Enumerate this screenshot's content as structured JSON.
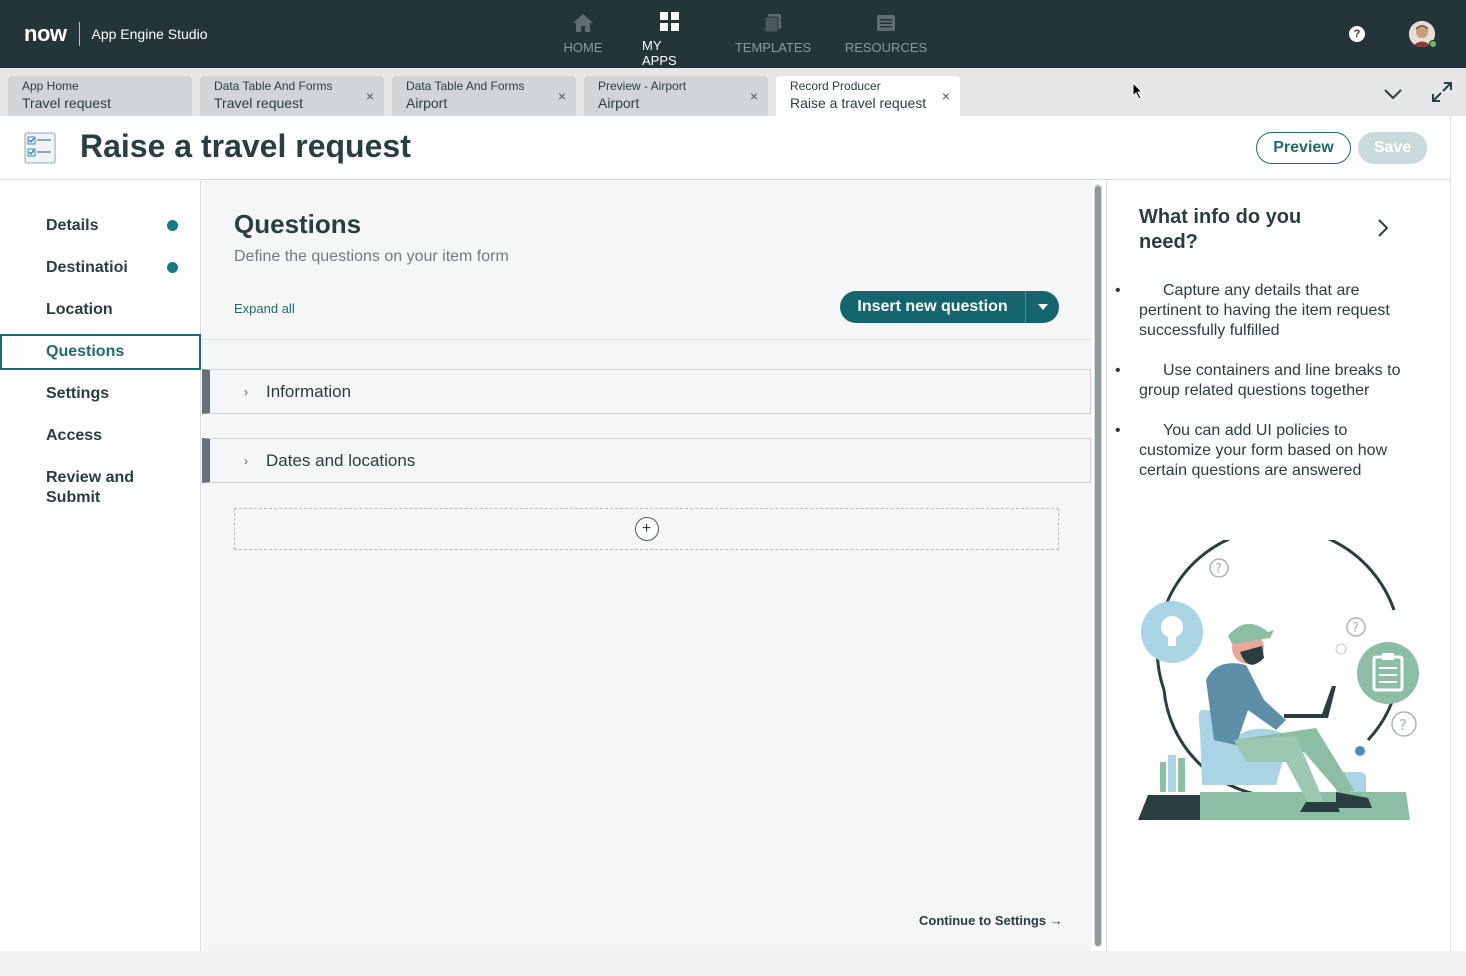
{
  "app": {
    "logo_text": "now",
    "name": "App Engine Studio",
    "help_symbol": "?"
  },
  "topnav": [
    {
      "label": "HOME",
      "icon": "home-icon",
      "active": false
    },
    {
      "label": "MY APPS",
      "icon": "grid-icon",
      "active": true
    },
    {
      "label": "TEMPLATES",
      "icon": "templates-icon",
      "active": false
    },
    {
      "label": "RESOURCES",
      "icon": "resources-icon",
      "active": false
    }
  ],
  "tabs": [
    {
      "type": "App Home",
      "name": "Travel request",
      "closable": false
    },
    {
      "type": "Data Table And Forms",
      "name": "Travel request",
      "closable": true
    },
    {
      "type": "Data Table And Forms",
      "name": "Airport",
      "closable": true
    },
    {
      "type": "Preview - Airport",
      "name": "Airport",
      "closable": true
    },
    {
      "type": "Record Producer",
      "name": "Raise a travel request",
      "closable": true,
      "active": true
    }
  ],
  "tab_close_symbol": "×",
  "header": {
    "title": "Raise a travel request",
    "preview_label": "Preview",
    "save_label": "Save"
  },
  "leftnav": [
    {
      "label": "Details",
      "complete": true
    },
    {
      "label": "Destinatioi",
      "complete": true
    },
    {
      "label": "Location",
      "complete": false
    },
    {
      "label": "Questions",
      "complete": false,
      "active": true
    },
    {
      "label": "Settings",
      "complete": false
    },
    {
      "label": "Access",
      "complete": false
    },
    {
      "label": "Review and Submit",
      "complete": false
    }
  ],
  "main": {
    "title": "Questions",
    "subtitle": "Define the questions on your item form",
    "expand_all": "Expand all",
    "insert_label": "Insert new question",
    "sections": [
      {
        "label": "Information"
      },
      {
        "label": "Dates and locations"
      }
    ],
    "section_chevron": "›",
    "add_symbol": "+",
    "continue_label": "Continue to Settings →"
  },
  "right_panel": {
    "title": "What info do you need?",
    "tips": [
      "Capture any details that are pertinent to having the item request successfully fulfilled",
      "Use containers and line breaks to group related questions together",
      "You can add UI policies to customize your form based on how certain questions are answered"
    ]
  },
  "colors": {
    "topbar": "#243539",
    "accent": "#14666e",
    "status_dot": "#117c85"
  }
}
